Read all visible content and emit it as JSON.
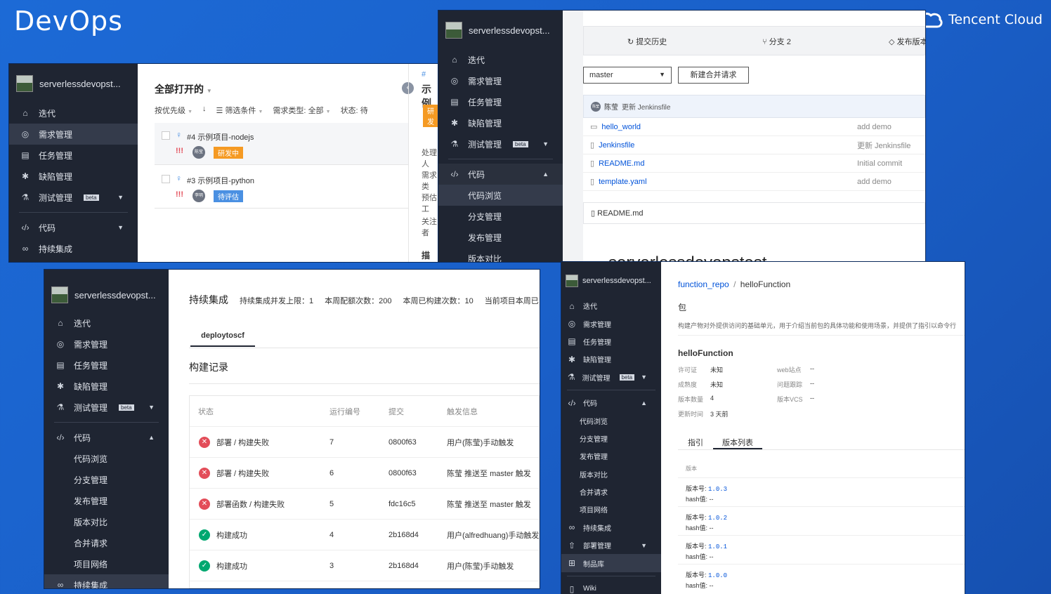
{
  "brand": "DevOps",
  "tencent_logo": "Tencent Cloud",
  "nav_labels": {
    "iter": "迭代",
    "req": "需求管理",
    "task": "任务管理",
    "bug": "缺陷管理",
    "test": "测试管理",
    "beta": "beta",
    "code": "代码",
    "ci": "持续集成",
    "browse": "代码浏览",
    "branch": "分支管理",
    "release": "发布管理",
    "compare": "版本对比",
    "merge": "合并请求",
    "network": "项目网络",
    "deploy": "部署管理",
    "artifacts": "制品库",
    "wiki": "Wiki"
  },
  "project_name": "serverlessdevopst...",
  "win1": {
    "title": "全部打开的",
    "filters": {
      "priority": "按优先级",
      "sort_icon": "arrow-down",
      "filter": "筛选条件",
      "type_label": "需求类型:",
      "type_value": "全部",
      "status_label": "状态:",
      "status_value": "待"
    },
    "items": [
      {
        "title": "#4 示例项目-nodejs",
        "priority": "!!!",
        "avatar": "陈莹",
        "tag": "研发中",
        "tag_color": "#f59a23"
      },
      {
        "title": "#3 示例项目-python",
        "priority": "!!!",
        "avatar": "李明",
        "tag": "待评估",
        "tag_color": "#4a90e2"
      }
    ],
    "detail": {
      "id": "#",
      "title": "示例",
      "tag": "研发",
      "l1": "处理人",
      "l2": "需求类",
      "l3": "预估工",
      "l4": "关注者",
      "l5": "描述"
    }
  },
  "win2": {
    "tabs": {
      "history": "提交历史",
      "branches": "分支 2",
      "release": "发布版本"
    },
    "branch_select": "master",
    "new_mr": "新建合并请求",
    "commit": {
      "avatar": "陈莹",
      "author": "陈莹",
      "msg": "更新 Jenkinsfile"
    },
    "files": [
      {
        "name": "hello_world",
        "type": "folder",
        "msg": "add demo"
      },
      {
        "name": "Jenkinsfile",
        "type": "file",
        "msg": "更新 Jenkinsfile"
      },
      {
        "name": "README.md",
        "type": "file",
        "msg": "Initial commit"
      },
      {
        "name": "template.yaml",
        "type": "file",
        "msg": "add demo"
      }
    ],
    "readme_header": "README.md",
    "readme_title": "serverlessdevopstest"
  },
  "win3": {
    "title": "持续集成",
    "stats": {
      "concurrency": "持续集成并发上限：1",
      "quota": "本周配额次数：200",
      "used": "本周已构建次数：10",
      "current": "当前项目本周已"
    },
    "tab": "deploytoscf",
    "section": "构建记录",
    "columns": [
      "状态",
      "运行编号",
      "提交",
      "触发信息"
    ],
    "builds": [
      {
        "status": "fail",
        "label": "部署 / 构建失败",
        "num": "7",
        "commit": "0800f63",
        "trigger": "用户(陈莹)手动触发"
      },
      {
        "status": "fail",
        "label": "部署 / 构建失败",
        "num": "6",
        "commit": "0800f63",
        "trigger": "陈莹 推送至 master 触发"
      },
      {
        "status": "fail",
        "label": "部署函数 / 构建失败",
        "num": "5",
        "commit": "fdc16c5",
        "trigger": "陈莹 推送至 master 触发"
      },
      {
        "status": "ok",
        "label": "构建成功",
        "num": "4",
        "commit": "2b168d4",
        "trigger": "用户(alfredhuang)手动触发"
      },
      {
        "status": "ok",
        "label": "构建成功",
        "num": "3",
        "commit": "2b168d4",
        "trigger": "用户(陈莹)手动触发"
      }
    ]
  },
  "win4": {
    "breadcrumb": {
      "repo": "function_repo",
      "sep": "/",
      "pkg": "helloFunction"
    },
    "heading": "包",
    "desc": "构建产物对外提供访问的基础单元，用于介绍当前包的具体功能和使用场景，并提供了指引以命令行",
    "pkg_name": "helloFunction",
    "props": [
      {
        "k": "许可证",
        "v": "未知",
        "k2": "web站点",
        "v2": "--"
      },
      {
        "k": "成熟度",
        "v": "未知",
        "k2": "问题跟踪",
        "v2": "--"
      },
      {
        "k": "版本数量",
        "v": "4",
        "k2": "版本VCS",
        "v2": "--"
      },
      {
        "k": "更新时间",
        "v": "3 天前",
        "k2": "",
        "v2": ""
      }
    ],
    "tabs": {
      "guide": "指引",
      "versions": "版本列表"
    },
    "ver_col": "版本",
    "ver_label": "版本号:",
    "hash_label": "hash值:",
    "versions": [
      {
        "v": "1.0.3",
        "h": "--"
      },
      {
        "v": "1.0.2",
        "h": "--"
      },
      {
        "v": "1.0.1",
        "h": "--"
      },
      {
        "v": "1.0.0",
        "h": "--"
      }
    ]
  }
}
